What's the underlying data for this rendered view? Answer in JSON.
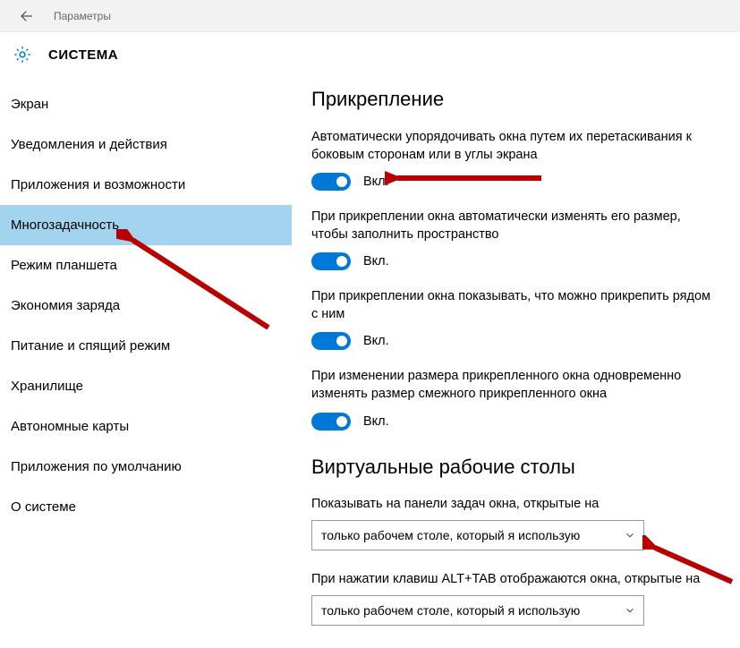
{
  "header": {
    "title": "Параметры"
  },
  "page": {
    "heading": "СИСТЕМА"
  },
  "sidebar": {
    "items": [
      {
        "label": "Экран"
      },
      {
        "label": "Уведомления и действия"
      },
      {
        "label": "Приложения и возможности"
      },
      {
        "label": "Многозадачность"
      },
      {
        "label": "Режим планшета"
      },
      {
        "label": "Экономия заряда"
      },
      {
        "label": "Питание и спящий режим"
      },
      {
        "label": "Хранилище"
      },
      {
        "label": "Автономные карты"
      },
      {
        "label": "Приложения по умолчанию"
      },
      {
        "label": "О системе"
      }
    ],
    "selected_index": 3
  },
  "content": {
    "section1_title": "Прикрепление",
    "settings": [
      {
        "text": "Автоматически упорядочивать окна путем их перетаскивания к боковым сторонам или в углы экрана",
        "state_label": "Вкл."
      },
      {
        "text": "При прикреплении окна автоматически изменять его размер, чтобы заполнить пространство",
        "state_label": "Вкл."
      },
      {
        "text": "При прикреплении окна показывать, что можно прикрепить рядом с ним",
        "state_label": "Вкл."
      },
      {
        "text": "При изменении размера прикрепленного окна одновременно изменять размер смежного прикрепленного окна",
        "state_label": "Вкл."
      }
    ],
    "section2_title": "Виртуальные рабочие столы",
    "dropdown1": {
      "text": "Показывать на панели задач окна, открытые на",
      "value": "только рабочем столе, который я использую"
    },
    "dropdown2": {
      "text": "При нажатии клавиш ALT+TAB отображаются окна, открытые на",
      "value": "только рабочем столе, который я использую"
    }
  }
}
